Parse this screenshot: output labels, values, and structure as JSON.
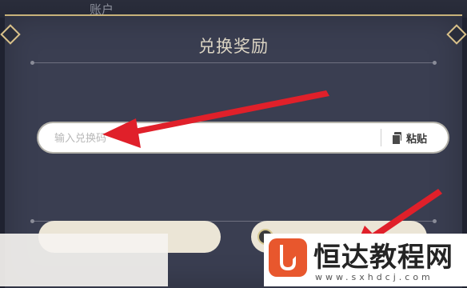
{
  "header": {
    "account_label": "账户"
  },
  "dialog": {
    "title": "兑换奖励"
  },
  "code_input": {
    "value": "",
    "placeholder": "输入兑换码"
  },
  "paste": {
    "label": "粘贴"
  },
  "watermark": {
    "name": "恒达教程网",
    "url": "www.sxhdcj.com"
  },
  "colors": {
    "dialog_bg": "#3a3e51",
    "gold_border": "#c8b27a",
    "arrow": "#e0202a",
    "brand": "#e8572d"
  }
}
